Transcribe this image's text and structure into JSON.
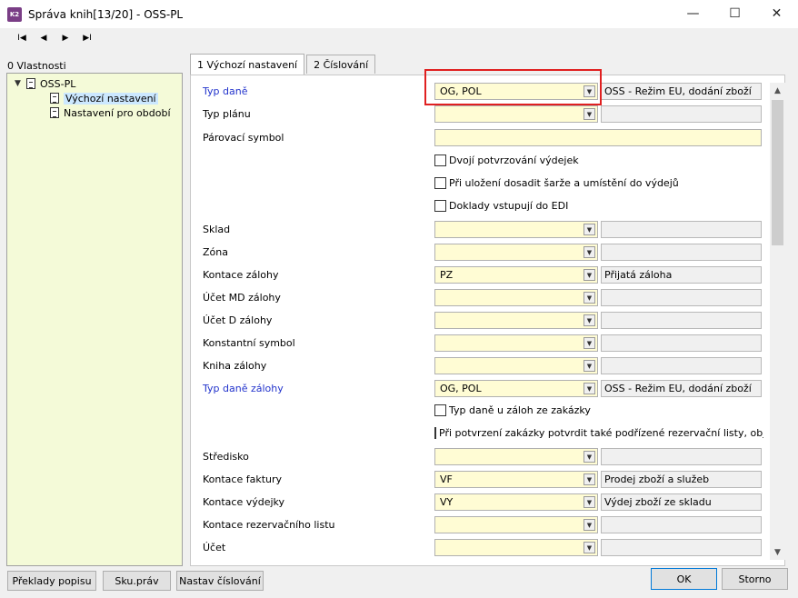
{
  "window": {
    "icon_text": "K2",
    "title": "Správa knih[13/20] - OSS-PL"
  },
  "toolbar": {
    "first": "I◀",
    "prev": "◀",
    "next": "▶",
    "last": "▶I"
  },
  "left_panel": {
    "label": "0 Vlastnosti",
    "tree": {
      "root": "OSS-PL",
      "children": [
        "Výchozí nastavení",
        "Nastavení pro období"
      ]
    }
  },
  "tabs": [
    {
      "label": "1 Výchozí nastavení",
      "active": true
    },
    {
      "label": "2 Číslování",
      "active": false
    }
  ],
  "form": {
    "typ_dane": {
      "label": "Typ daně",
      "value": "OG, POL",
      "desc": "OSS - Režim EU, dodání zboží"
    },
    "typ_planu": {
      "label": "Typ plánu",
      "value": "",
      "desc": ""
    },
    "parovaci_symbol": {
      "label": "Párovací symbol",
      "value": ""
    },
    "check_dvoji": "Dvojí potvrzování výdejek",
    "check_sarze": "Při uložení dosadit šarže a umístění do výdejů",
    "check_edi": "Doklady vstupují do EDI",
    "sklad": {
      "label": "Sklad",
      "value": "",
      "desc": ""
    },
    "zona": {
      "label": "Zóna",
      "value": "",
      "desc": ""
    },
    "kontace_zalohy": {
      "label": "Kontace zálohy",
      "value": "PZ",
      "desc": "Přijatá záloha"
    },
    "ucet_md_zalohy": {
      "label": "Účet MD zálohy",
      "value": "",
      "desc": ""
    },
    "ucet_d_zalohy": {
      "label": "Účet D zálohy",
      "value": "",
      "desc": ""
    },
    "konstantni_symbol": {
      "label": "Konstantní symbol",
      "value": "",
      "desc": ""
    },
    "kniha_zalohy": {
      "label": "Kniha zálohy",
      "value": "",
      "desc": ""
    },
    "typ_dane_zalohy": {
      "label": "Typ daně zálohy",
      "value": "OG, POL",
      "desc": "OSS - Režim EU, dodání zboží"
    },
    "check_typ_dane_zakazky": "Typ daně u záloh ze zakázky",
    "check_potvrzeni": "Při potvrzení zakázky potvrdit také podřízené rezervační listy, objednávl",
    "stredisko": {
      "label": "Středisko",
      "value": "",
      "desc": ""
    },
    "kontace_faktury": {
      "label": "Kontace faktury",
      "value": "VF",
      "desc": "Prodej zboží a služeb"
    },
    "kontace_vydejky": {
      "label": "Kontace výdejky",
      "value": "VY",
      "desc": "Výdej zboží ze skladu"
    },
    "kontace_rezervacniho_listu": {
      "label": "Kontace rezervačního listu",
      "value": "",
      "desc": ""
    },
    "ucet": {
      "label": "Účet",
      "value": "",
      "desc": ""
    }
  },
  "buttons": {
    "preklady": "Překlady popisu",
    "sku_prav": "Sku.práv",
    "nastav_cislovani": "Nastav číslování",
    "ok": "OK",
    "storno": "Storno"
  },
  "colors": {
    "input_yellow": "#fffcd4",
    "tree_bg": "#f4fad8",
    "label_blue": "#2233cc",
    "highlight_red": "#e02020"
  }
}
